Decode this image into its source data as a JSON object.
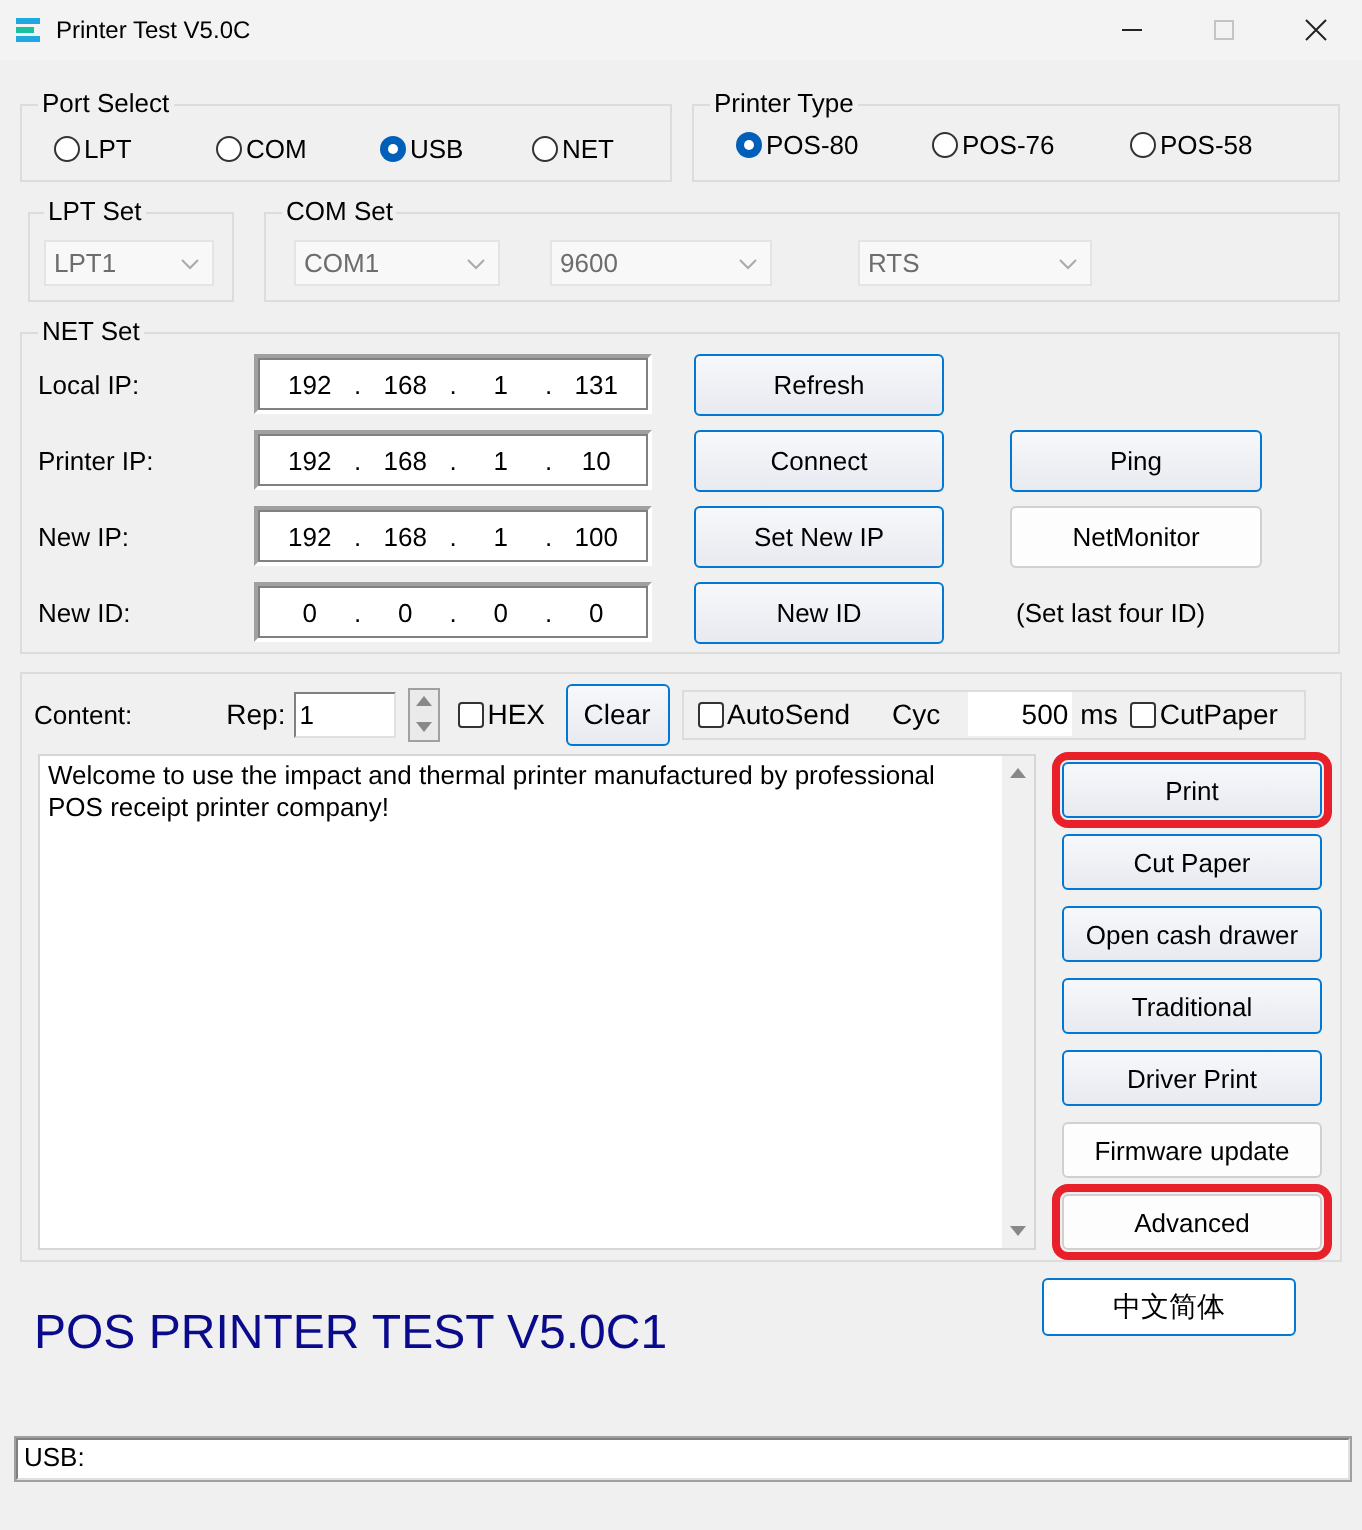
{
  "window": {
    "title": "Printer Test V5.0C",
    "controls": [
      {
        "kind": "minimize",
        "disabled": false
      },
      {
        "kind": "maximize",
        "disabled": true
      },
      {
        "kind": "close",
        "disabled": false
      }
    ]
  },
  "port_select": {
    "title": "Port Select",
    "options": [
      {
        "label": "LPT",
        "selected": false
      },
      {
        "label": "COM",
        "selected": false
      },
      {
        "label": "USB",
        "selected": true
      },
      {
        "label": "NET",
        "selected": false
      }
    ]
  },
  "printer_type": {
    "title": "Printer Type",
    "options": [
      {
        "label": "POS-80",
        "selected": true
      },
      {
        "label": "POS-76",
        "selected": false
      },
      {
        "label": "POS-58",
        "selected": false
      }
    ]
  },
  "lpt_set": {
    "title": "LPT Set",
    "selects": [
      {
        "value": "LPT1",
        "disabled": true
      }
    ]
  },
  "com_set": {
    "title": "COM Set",
    "selects": [
      {
        "value": "COM1",
        "disabled": true
      },
      {
        "value": "9600",
        "disabled": true
      },
      {
        "value": "RTS",
        "disabled": true
      }
    ]
  },
  "net_set": {
    "title": "NET Set",
    "rows": [
      {
        "label": "Local IP:",
        "octets": [
          "192",
          "168",
          "1",
          "131"
        ],
        "separators": [
          ".",
          ".",
          "."
        ],
        "button": "Refresh"
      },
      {
        "label": "Printer IP:",
        "octets": [
          "192",
          "168",
          "1",
          "10"
        ],
        "separators": [
          ".",
          ".",
          "."
        ],
        "button": "Connect",
        "side": {
          "kind": "accent_button",
          "label": "Ping"
        }
      },
      {
        "label": "New IP:",
        "octets": [
          "192",
          "168",
          "1",
          "100"
        ],
        "separators": [
          ".",
          ".",
          "."
        ],
        "button": "Set New IP",
        "side": {
          "kind": "plain_button",
          "label": "NetMonitor"
        }
      },
      {
        "label": "New ID:",
        "octets": [
          "0",
          "0",
          "0",
          "0"
        ],
        "separators": [
          ".",
          ".",
          "."
        ],
        "button": "New ID",
        "side": {
          "kind": "note",
          "label": "(Set last four ID)"
        }
      }
    ]
  },
  "content": {
    "label": "Content:",
    "rep_label": "Rep:",
    "rep_value": "1",
    "hex": {
      "label": "HEX",
      "checked": false
    },
    "clear_button": "Clear",
    "autosend": {
      "label": "AutoSend",
      "checked": false
    },
    "cyc_label": "Cyc",
    "cyc_value": "500",
    "ms_label": "ms",
    "cutpaper": {
      "label": "CutPaper",
      "checked": false
    },
    "text": "Welcome to use the impact and thermal printer manufactured by professional POS receipt printer company!"
  },
  "actions": [
    {
      "label": "Print",
      "kind": "accent",
      "highlighted": true
    },
    {
      "label": "Cut Paper",
      "kind": "accent",
      "highlighted": false
    },
    {
      "label": "Open cash drawer",
      "kind": "accent",
      "highlighted": false
    },
    {
      "label": "Traditional",
      "kind": "accent",
      "highlighted": false
    },
    {
      "label": "Driver Print",
      "kind": "accent",
      "highlighted": false
    },
    {
      "label": "Firmware update",
      "kind": "plain",
      "highlighted": false
    },
    {
      "label": "Advanced",
      "kind": "plain",
      "highlighted": true
    }
  ],
  "banner": "POS PRINTER TEST V5.0C1",
  "language_button": "中文简体",
  "status_bar": "USB:"
}
